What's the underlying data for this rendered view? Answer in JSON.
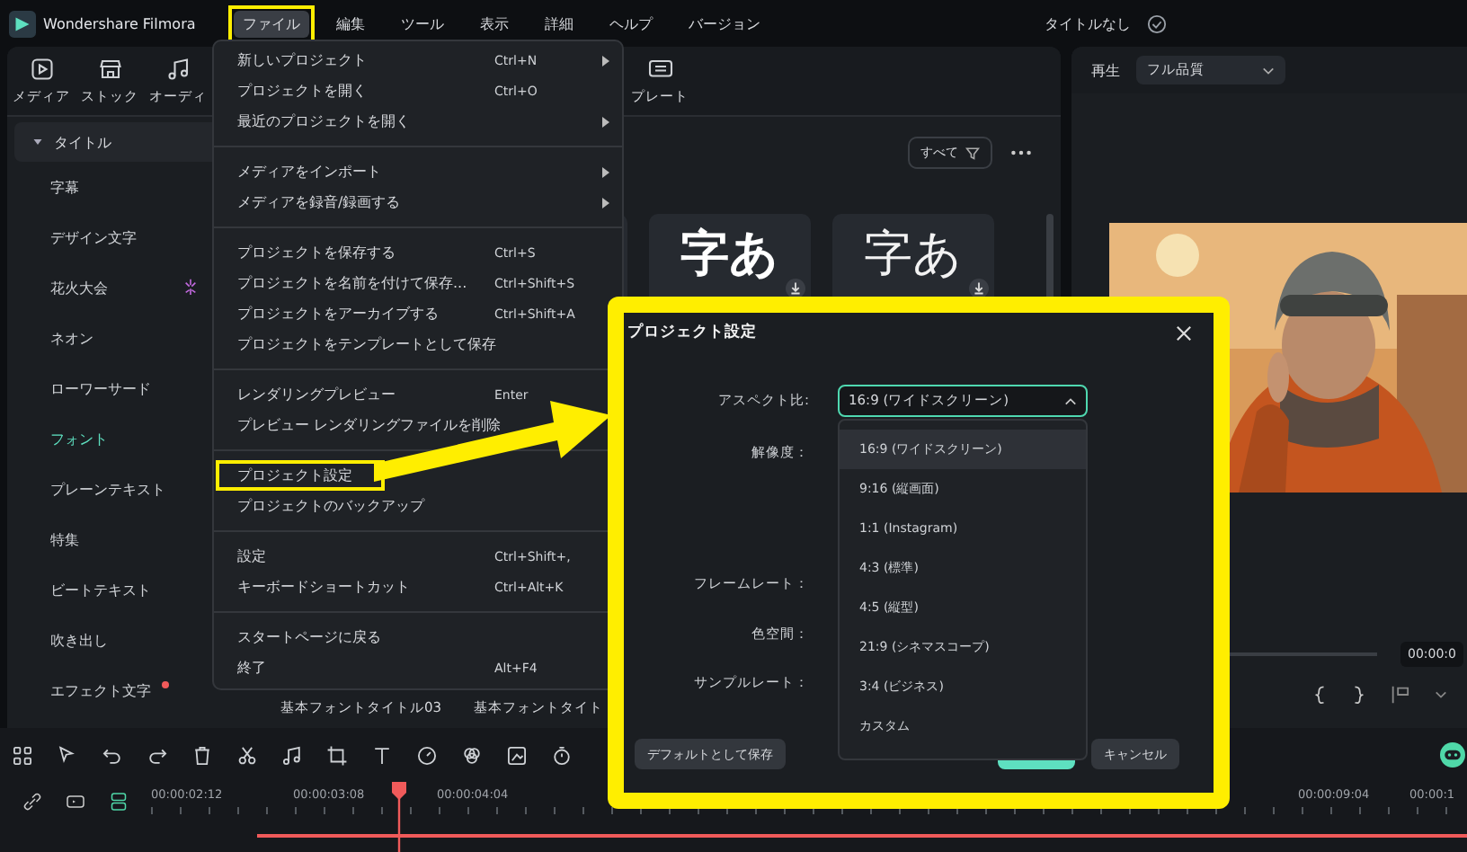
{
  "app": {
    "name": "Wondershare Filmora"
  },
  "menubar": [
    {
      "label": "ファイル",
      "selected": true,
      "annotated": true
    },
    {
      "label": "編集",
      "selected": false,
      "annotated": false
    },
    {
      "label": "ツール",
      "selected": false,
      "annotated": false
    },
    {
      "label": "表示",
      "selected": false,
      "annotated": false
    },
    {
      "label": "詳細",
      "selected": false,
      "annotated": false
    },
    {
      "label": "ヘルプ",
      "selected": false,
      "annotated": false
    },
    {
      "label": "バージョン",
      "selected": false,
      "annotated": false
    }
  ],
  "project_title": "タイトルなし",
  "toolbar": [
    {
      "label": "メディア"
    },
    {
      "label": "ストック"
    },
    {
      "label": "オーディ"
    },
    {
      "label": "プレート"
    }
  ],
  "sidebar": {
    "header": {
      "label": "タイトル",
      "expanded": true
    },
    "items": [
      {
        "label": "字幕",
        "selected": false,
        "new_dot": false,
        "sparkle": false
      },
      {
        "label": "デザイン文字",
        "selected": false,
        "new_dot": false,
        "sparkle": false
      },
      {
        "label": "花火大会",
        "selected": false,
        "new_dot": false,
        "sparkle": true
      },
      {
        "label": "ネオン",
        "selected": false,
        "new_dot": false,
        "sparkle": false
      },
      {
        "label": "ローワーサード",
        "selected": false,
        "new_dot": false,
        "sparkle": false
      },
      {
        "label": "フォント",
        "selected": true,
        "new_dot": false,
        "sparkle": false
      },
      {
        "label": "プレーンテキスト",
        "selected": false,
        "new_dot": false,
        "sparkle": false
      },
      {
        "label": "特集",
        "selected": false,
        "new_dot": false,
        "sparkle": false
      },
      {
        "label": "ビートテキスト",
        "selected": false,
        "new_dot": false,
        "sparkle": false
      },
      {
        "label": "吹き出し",
        "selected": false,
        "new_dot": false,
        "sparkle": false
      },
      {
        "label": "エフェクト文字",
        "selected": false,
        "new_dot": true,
        "sparkle": false
      }
    ]
  },
  "content": {
    "filter": "すべて",
    "cards": [
      {
        "kind": "blank"
      },
      {
        "kind": "glyph",
        "glyph": "字あ",
        "bold": true
      },
      {
        "kind": "glyph",
        "glyph": "字あ",
        "bold": false
      }
    ],
    "captions": [
      "基本フォントタイトル03",
      "基本フォントタイト"
    ]
  },
  "file_menu": [
    [
      {
        "label": "新しいプロジェクト",
        "shortcut": "Ctrl+N",
        "submenu": true,
        "annotated": false
      },
      {
        "label": "プロジェクトを開く",
        "shortcut": "Ctrl+O",
        "annotated": false
      },
      {
        "label": "最近のプロジェクトを開く",
        "submenu": true,
        "annotated": false
      }
    ],
    [
      {
        "label": "メディアをインポート",
        "submenu": true,
        "annotated": false
      },
      {
        "label": "メディアを録音/録画する",
        "submenu": true,
        "annotated": false
      }
    ],
    [
      {
        "label": "プロジェクトを保存する",
        "shortcut": "Ctrl+S",
        "annotated": false
      },
      {
        "label": "プロジェクトを名前を付けて保存...",
        "shortcut": "Ctrl+Shift+S",
        "annotated": false
      },
      {
        "label": "プロジェクトをアーカイブする",
        "shortcut": "Ctrl+Shift+A",
        "annotated": false
      },
      {
        "label": "プロジェクトをテンプレートとして保存",
        "annotated": false
      }
    ],
    [
      {
        "label": "レンダリングプレビュー",
        "shortcut": "Enter",
        "annotated": false
      },
      {
        "label": "プレビュー レンダリングファイルを削除",
        "annotated": false
      }
    ],
    [
      {
        "label": "プロジェクト設定",
        "annotated": true
      },
      {
        "label": "プロジェクトのバックアップ",
        "annotated": false
      }
    ],
    [
      {
        "label": "設定",
        "shortcut": "Ctrl+Shift+,",
        "annotated": false
      },
      {
        "label": "キーボードショートカット",
        "shortcut": "Ctrl+Alt+K",
        "annotated": false
      }
    ],
    [
      {
        "label": "スタートページに戻る",
        "annotated": false
      },
      {
        "label": "終了",
        "shortcut": "Alt+F4",
        "annotated": false
      }
    ]
  ],
  "preview": {
    "mode": "再生",
    "quality": "フル品質",
    "time": "00:00:0"
  },
  "dialog": {
    "title": "プロジェクト設定",
    "annotated": true,
    "labels": [
      "アスペクト比:",
      "解像度：",
      "フレームレート：",
      "色空間：",
      "サンプルレート："
    ],
    "aspect_value": "16:9 (ワイドスクリーン)",
    "expanded": true,
    "options": [
      {
        "label": "16:9 (ワイドスクリーン)",
        "selected": true
      },
      {
        "label": "9:16 (縦画面)",
        "selected": false
      },
      {
        "label": "1:1 (Instagram)",
        "selected": false
      },
      {
        "label": "4:3 (標準)",
        "selected": false
      },
      {
        "label": "4:5 (縦型)",
        "selected": false
      },
      {
        "label": "21:9 (シネマスコープ)",
        "selected": false
      },
      {
        "label": "3:4 (ビジネス)",
        "selected": false
      },
      {
        "label": "カスタム",
        "selected": false
      }
    ],
    "save_default": "デフォルトとして保存",
    "cancel": "キャンセル"
  },
  "timeline": {
    "times": [
      "00:00:02:12",
      "00:00:03:08",
      "00:00:04:04",
      "00:00:09:04",
      "00:00:1"
    ]
  }
}
